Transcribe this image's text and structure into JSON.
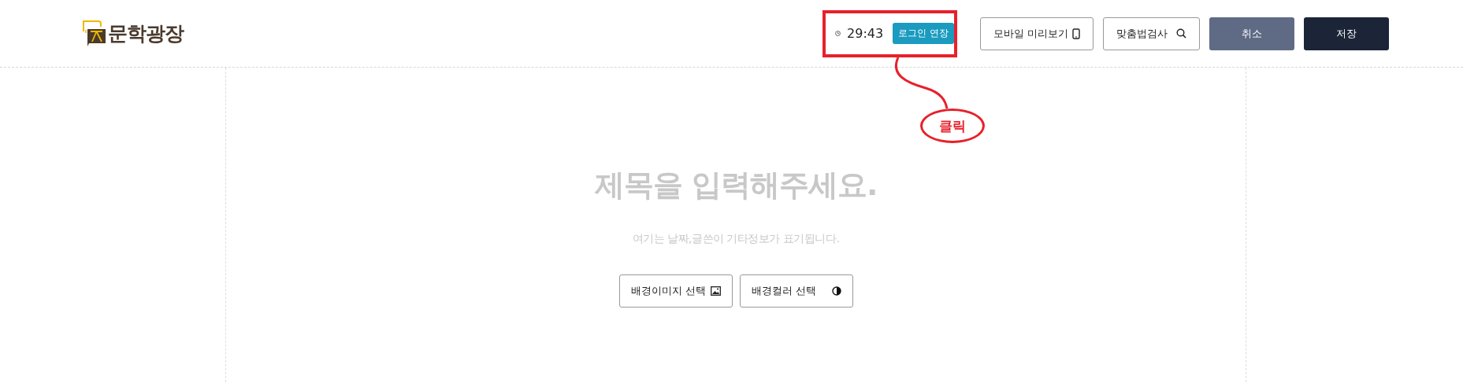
{
  "logo": {
    "text": "문학광장"
  },
  "session": {
    "time": "29:43",
    "extend_button": "로그인 연장"
  },
  "header_buttons": [
    {
      "label": "모바일 미리보기",
      "kind": "outline"
    },
    {
      "label": "맞춤법검사",
      "kind": "outline"
    },
    {
      "label": "취소",
      "kind": "gray"
    },
    {
      "label": "저장",
      "kind": "dark"
    }
  ],
  "editor": {
    "title_placeholder": "제목을 입력해주세요.",
    "meta_placeholder": "여기는 날짜,글쓴이 기타정보가 표기됩니다.",
    "buttons": [
      {
        "label": "배경이미지 선택"
      },
      {
        "label": "배경컬러 선택"
      }
    ]
  },
  "annotation": {
    "text": "클릭"
  }
}
